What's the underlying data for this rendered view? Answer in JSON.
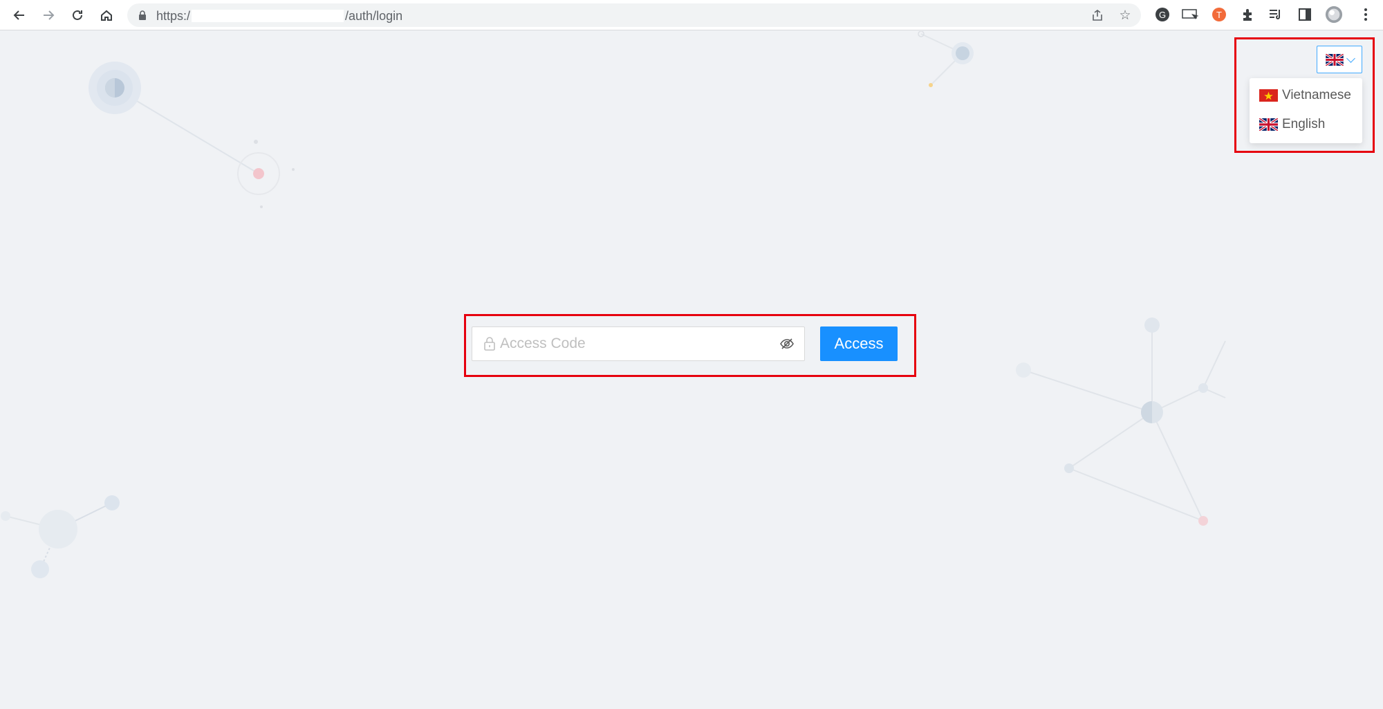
{
  "browser": {
    "url_prefix": "https:/",
    "url_suffix": "/auth/login"
  },
  "language": {
    "current": "English",
    "options": [
      "Vietnamese",
      "English"
    ]
  },
  "login": {
    "placeholder": "Access Code",
    "button_label": "Access"
  },
  "colors": {
    "primary": "#1890ff",
    "highlight": "#e6000e",
    "background": "#f0f2f5"
  }
}
